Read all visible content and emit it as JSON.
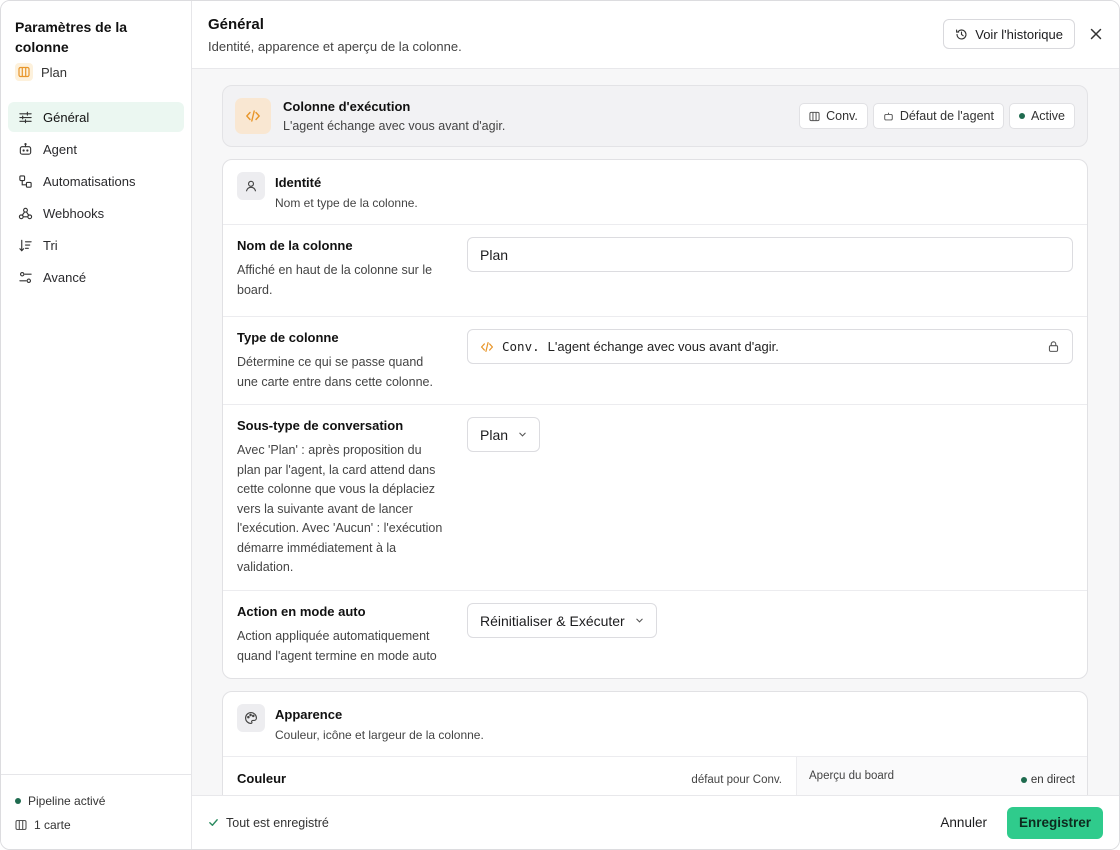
{
  "sidebar": {
    "title": "Paramètres de la colonne",
    "column_name": "Plan",
    "items": [
      {
        "label": "Général",
        "icon": "sliders-icon",
        "active": true
      },
      {
        "label": "Agent",
        "icon": "robot-icon"
      },
      {
        "label": "Automatisations",
        "icon": "workflow-icon"
      },
      {
        "label": "Webhooks",
        "icon": "webhook-icon"
      },
      {
        "label": "Tri",
        "icon": "sort-icon"
      },
      {
        "label": "Avancé",
        "icon": "settings-toggle-icon"
      }
    ],
    "footer": {
      "pipeline_status": "Pipeline activé",
      "card_count": "1 carte"
    }
  },
  "header": {
    "title": "Général",
    "subtitle": "Identité, apparence et aperçu de la colonne.",
    "history_button": "Voir l'historique"
  },
  "exec_card": {
    "title": "Colonne d'exécution",
    "description": "L'agent échange avec vous avant d'agir.",
    "tags": [
      "Conv.",
      "Défaut de l'agent",
      "Active"
    ]
  },
  "identity": {
    "title": "Identité",
    "description": "Nom et type de la colonne.",
    "name_field": {
      "label": "Nom de la colonne",
      "help": "Affiché en haut de la colonne sur le board.",
      "value": "Plan"
    },
    "type_field": {
      "label": "Type de colonne",
      "help": "Détermine ce qui se passe quand une carte entre dans cette colonne.",
      "code": "Conv.",
      "value": "L'agent échange avec vous avant d'agir."
    },
    "subtype_field": {
      "label": "Sous-type de conversation",
      "help": "Avec 'Plan' : après proposition du plan par l'agent, la card attend dans cette colonne que vous la déplaciez vers la suivante avant de lancer l'exécution. Avec 'Aucun' : l'exécution démarre immédiatement à la validation.",
      "value": "Plan"
    },
    "auto_action_field": {
      "label": "Action en mode auto",
      "help": "Action appliquée automatiquement quand l'agent termine en mode auto",
      "value": "Réinitialiser & Exécuter"
    }
  },
  "appearance": {
    "title": "Apparence",
    "description": "Couleur, icône et largeur de la colonne.",
    "color_label": "Couleur",
    "color_default": "défaut pour Conv.",
    "preview_label": "Aperçu du board",
    "live_label": "en direct"
  },
  "footer": {
    "saved_status": "Tout est enregistré",
    "cancel": "Annuler",
    "save": "Enregistrer"
  },
  "colors": {
    "accent": "#2fcb8c",
    "active_nav_bg": "#ebf7f1",
    "status_dot": "#1f6b4f",
    "exec_icon_bg": "#f9e7d2",
    "exec_icon": "#e8962b"
  }
}
